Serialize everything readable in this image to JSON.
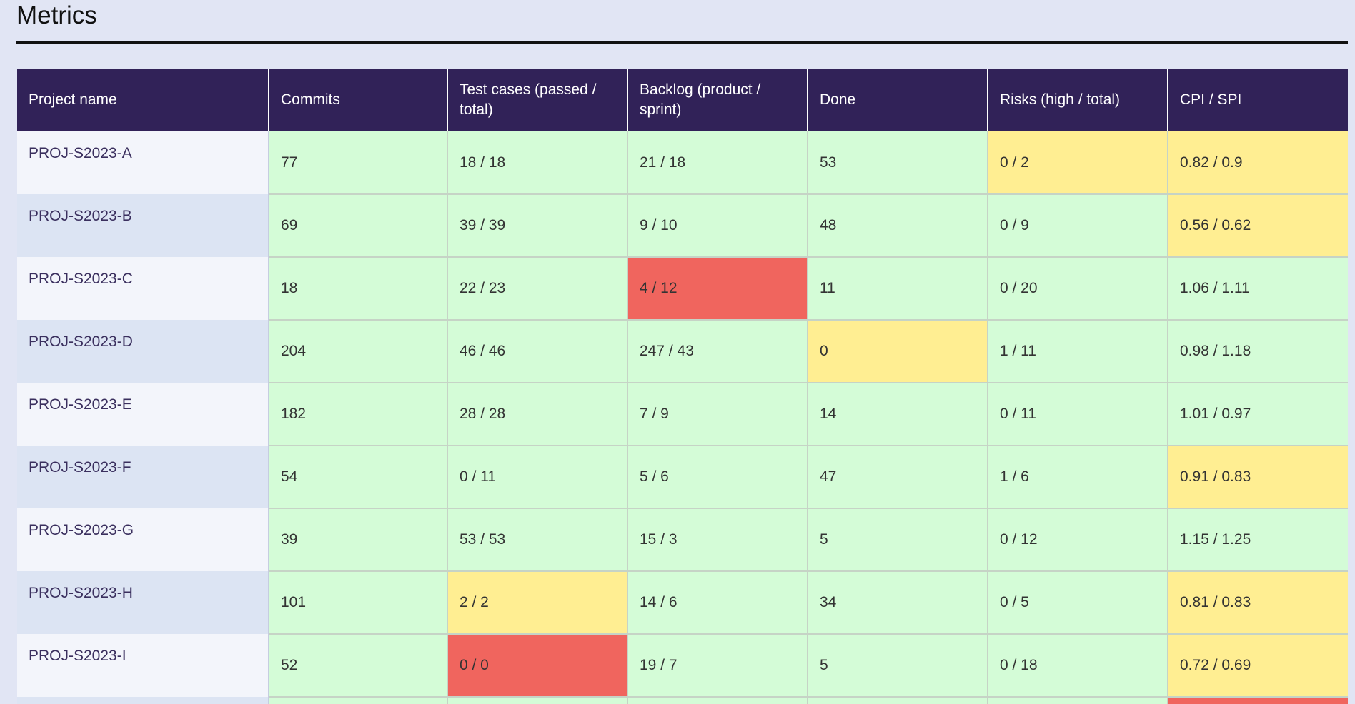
{
  "page": {
    "title": "Metrics"
  },
  "colors": {
    "header_bg": "#312258",
    "ok": "#d4fcd7",
    "warn": "#ffee92",
    "bad": "#f0655e",
    "page_bg": "#e1e5f4"
  },
  "table": {
    "headers": [
      "Project name",
      "Commits",
      "Test cases (passed / total)",
      "Backlog (product / sprint)",
      "Done",
      "Risks (high / total)",
      "CPI / SPI"
    ],
    "rows": [
      {
        "name": "PROJ-S2023-A",
        "commits": "77",
        "tests": "18 / 18",
        "backlog": "21 / 18",
        "done": "53",
        "risks": "0 / 2",
        "cpi_spi": "0.82 / 0.9"
      },
      {
        "name": "PROJ-S2023-B",
        "commits": "69",
        "tests": "39 / 39",
        "backlog": "9 / 10",
        "done": "48",
        "risks": "0 / 9",
        "cpi_spi": "0.56 / 0.62"
      },
      {
        "name": "PROJ-S2023-C",
        "commits": "18",
        "tests": "22 / 23",
        "backlog": "4 / 12",
        "done": "11",
        "risks": "0 / 20",
        "cpi_spi": "1.06 / 1.11"
      },
      {
        "name": "PROJ-S2023-D",
        "commits": "204",
        "tests": "46 / 46",
        "backlog": "247 / 43",
        "done": "0",
        "risks": "1 / 11",
        "cpi_spi": "0.98 / 1.18"
      },
      {
        "name": "PROJ-S2023-E",
        "commits": "182",
        "tests": "28 / 28",
        "backlog": "7 / 9",
        "done": "14",
        "risks": "0 / 11",
        "cpi_spi": "1.01 / 0.97"
      },
      {
        "name": "PROJ-S2023-F",
        "commits": "54",
        "tests": "0 / 11",
        "backlog": "5 / 6",
        "done": "47",
        "risks": "1 / 6",
        "cpi_spi": "0.91 / 0.83"
      },
      {
        "name": "PROJ-S2023-G",
        "commits": "39",
        "tests": "53 / 53",
        "backlog": "15 / 3",
        "done": "5",
        "risks": "0 / 12",
        "cpi_spi": "1.15 / 1.25"
      },
      {
        "name": "PROJ-S2023-H",
        "commits": "101",
        "tests": "2 / 2",
        "backlog": "14 / 6",
        "done": "34",
        "risks": "0 / 5",
        "cpi_spi": "0.81 / 0.83"
      },
      {
        "name": "PROJ-S2023-I",
        "commits": "52",
        "tests": "0 / 0",
        "backlog": "19 / 7",
        "done": "5",
        "risks": "0 / 18",
        "cpi_spi": "0.72 / 0.69"
      }
    ]
  }
}
